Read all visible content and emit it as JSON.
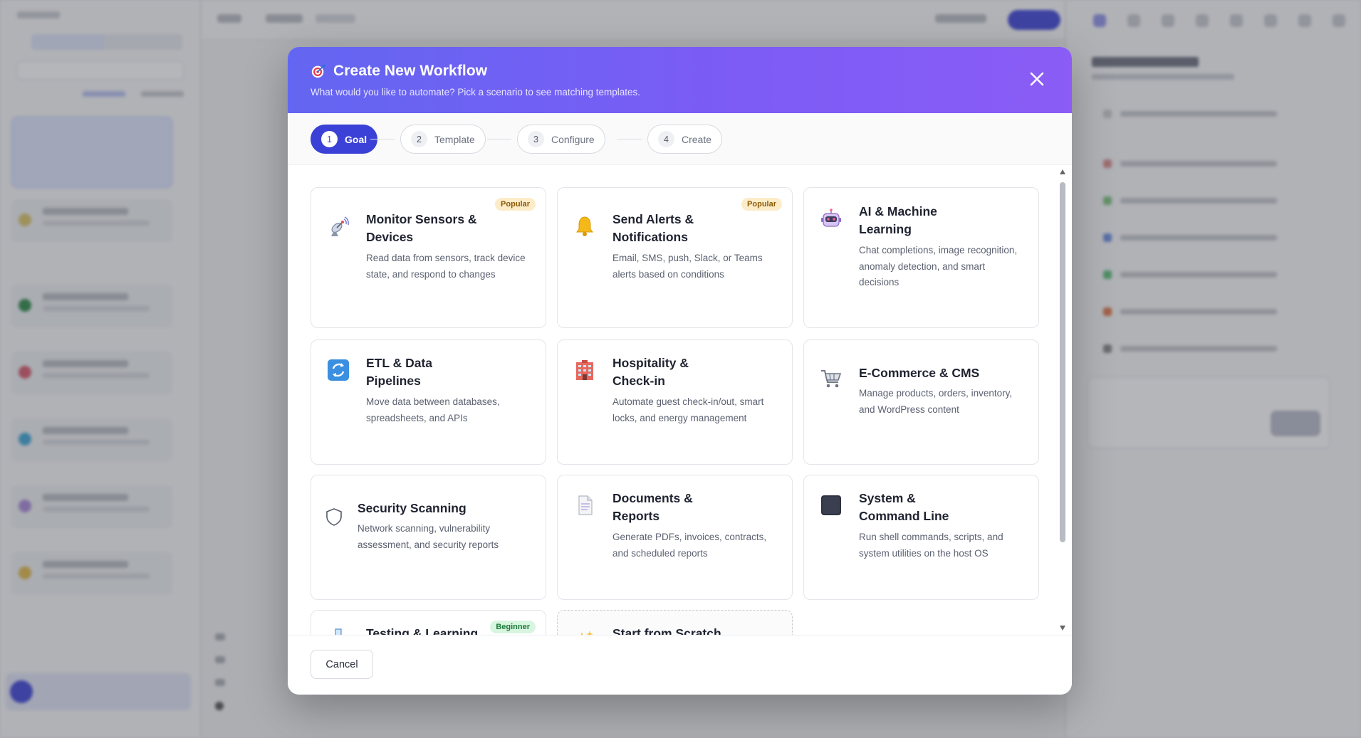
{
  "modal": {
    "title": "Create New Workflow",
    "subtitle": "What would you like to automate? Pick a scenario to see matching templates.",
    "title_icon": "target-icon",
    "close_icon": "close-icon",
    "cancel_label": "Cancel"
  },
  "steps": [
    {
      "num": "1",
      "label": "Goal",
      "active": true
    },
    {
      "num": "2",
      "label": "Template",
      "active": false
    },
    {
      "num": "3",
      "label": "Configure",
      "active": false
    },
    {
      "num": "4",
      "label": "Create",
      "active": false
    }
  ],
  "cards": [
    {
      "title": "Monitor Sensors & Devices",
      "desc": "Read data from sensors, track device state, and respond to changes",
      "badge": "Popular",
      "icon": "satellite-antenna-icon"
    },
    {
      "title": "Send Alerts & Notifications",
      "desc": "Email, SMS, push, Slack, or Teams alerts based on conditions",
      "badge": "Popular",
      "icon": "bell-icon"
    },
    {
      "title": "AI & Machine Learning",
      "desc": "Chat completions, image recognition, anomaly detection, and smart decisions",
      "badge": "",
      "icon": "robot-icon"
    },
    {
      "title": "ETL & Data Pipelines",
      "desc": "Move data between databases, spreadsheets, and APIs",
      "badge": "",
      "icon": "refresh-arrows-icon"
    },
    {
      "title": "Hospitality & Check-in",
      "desc": "Automate guest check-in/out, smart locks, and energy management",
      "badge": "",
      "icon": "hotel-icon"
    },
    {
      "title": "E-Commerce & CMS",
      "desc": "Manage products, orders, inventory, and WordPress content",
      "badge": "",
      "icon": "shopping-cart-icon"
    },
    {
      "title": "Security Scanning",
      "desc": "Network scanning, vulnerability assessment, and security reports",
      "badge": "",
      "icon": "shield-icon"
    },
    {
      "title": "Documents & Reports",
      "desc": "Generate PDFs, invoices, contracts, and scheduled reports",
      "badge": "",
      "icon": "document-icon"
    },
    {
      "title": "System & Command Line",
      "desc": "Run shell commands, scripts, and system utilities on the host OS",
      "badge": "",
      "icon": "terminal-icon"
    },
    {
      "title": "Testing & Learning",
      "desc": "",
      "badge": "Beginner",
      "icon": "flask-icon"
    },
    {
      "title": "Start from Scratch",
      "desc": "",
      "badge": "",
      "icon": "sparkles-icon"
    }
  ],
  "colors": {
    "header_start": "#6366f1",
    "header_end": "#8b5cf6",
    "active_step": "#3b41d6",
    "popular_badge": "#fdecc8",
    "beginner_badge": "#d8f5df"
  }
}
